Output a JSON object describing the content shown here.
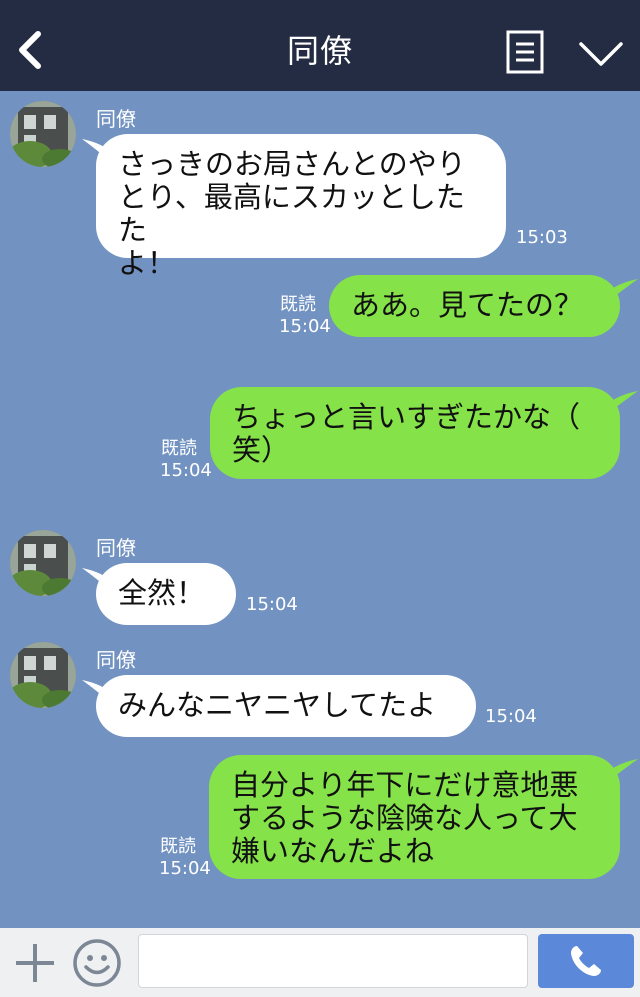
{
  "header": {
    "title": "同僚",
    "back_icon": "chevron-left-icon",
    "menu_icon": "memo-list-icon",
    "expand_icon": "chevron-down-icon"
  },
  "messages": [
    {
      "direction": "in",
      "sender": "同僚",
      "text_lines": [
        "さっきのお局さんとのやり",
        "とり、最高にスカッとしたた",
        "よ！"
      ],
      "time": "15:03"
    },
    {
      "direction": "out",
      "read": "既読",
      "text_lines": [
        "ああ。見てたの？"
      ],
      "time": "15:04"
    },
    {
      "direction": "out",
      "read": "既読",
      "text_lines": [
        "ちょっと言いすぎたかな（",
        "笑）"
      ],
      "time": "15:04"
    },
    {
      "direction": "in",
      "sender": "同僚",
      "text_lines": [
        "全然！"
      ],
      "time": "15:04"
    },
    {
      "direction": "in",
      "sender": "同僚",
      "text_lines": [
        "みんなニヤニヤしてたよ"
      ],
      "time": "15:04"
    },
    {
      "direction": "out",
      "read": "既読",
      "text_lines": [
        "自分より年下にだけ意地悪",
        "するような陰険な人って大",
        "嫌いなんだよね"
      ],
      "time": "15:04"
    }
  ],
  "footer": {
    "plus_icon": "plus-icon",
    "emoji_icon": "smiley-icon",
    "input_placeholder": "",
    "send_icon": "phone-icon"
  },
  "colors": {
    "header_bg": "#232c42",
    "chat_bg": "#7293c2",
    "bubble_in": "#ffffff",
    "bubble_out": "#85e249",
    "send_button": "#5b88d8"
  }
}
